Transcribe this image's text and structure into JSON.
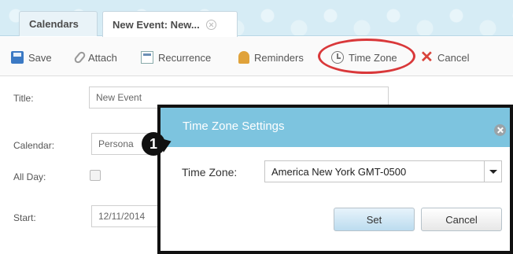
{
  "tabs": [
    {
      "label": "Calendars"
    },
    {
      "label": "New Event: New..."
    }
  ],
  "toolbar": {
    "save": "Save",
    "attach": "Attach",
    "recurrence": "Recurrence",
    "reminders": "Reminders",
    "time_zone": "Time Zone",
    "cancel": "Cancel"
  },
  "form": {
    "title_label": "Title:",
    "title_value": "New Event",
    "calendar_label": "Calendar:",
    "calendar_value": "Persona",
    "all_day_label": "All Day:",
    "start_label": "Start:",
    "start_value": "12/11/2014"
  },
  "dialog": {
    "title": "Time Zone Settings",
    "time_zone_label": "Time Zone:",
    "time_zone_value": "America New York GMT-0500",
    "set_button": "Set",
    "cancel_button": "Cancel"
  },
  "callout": {
    "step": "1"
  },
  "colors": {
    "dialog_header": "#7dc4df",
    "highlight_ring": "#d9383a",
    "cancel_icon": "#d9443b",
    "save_icon": "#3b79c4"
  }
}
